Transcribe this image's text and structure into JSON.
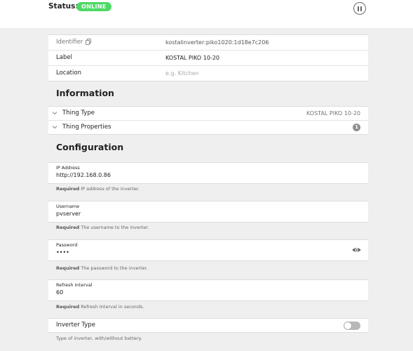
{
  "header": {
    "status_label": "Status:",
    "status_badge": "ONLINE",
    "pause_icon": "pause-circle-icon"
  },
  "properties": {
    "identifier_label": "Identifier",
    "identifier_value": "kostalinverter:piko1020:1d18e7c206",
    "label_label": "Label",
    "label_value": "KOSTAL PIKO 10-20",
    "location_label": "Location",
    "location_placeholder": "e.g. Kitchen"
  },
  "information": {
    "title": "Information",
    "thing_type_label": "Thing Type",
    "thing_type_value": "KOSTAL PIKO 10-20",
    "thing_properties_label": "Thing Properties",
    "thing_properties_count": "1"
  },
  "configuration": {
    "title": "Configuration",
    "fields": [
      {
        "label": "IP Address",
        "value": "http://192.168.0.86",
        "hint_required": "Required",
        "hint_text": " IP address of the inverter."
      },
      {
        "label": "Username",
        "value": "pvserver",
        "hint_required": "Required",
        "hint_text": " The username to the inverter."
      },
      {
        "label": "Password",
        "value": "••••",
        "hint_required": "Required",
        "hint_text": " The password to the inverter."
      },
      {
        "label": "Refresh Interval",
        "value": "60",
        "hint_required": "Required",
        "hint_text": " Refresh Interval in seconds."
      }
    ],
    "inverter_type_label": "Inverter Type",
    "inverter_type_hint": "Type of inverter, with/without battery.",
    "inverter_type_enabled": false
  },
  "colors": {
    "online": "#4cd964",
    "page_bg": "#efefef"
  }
}
